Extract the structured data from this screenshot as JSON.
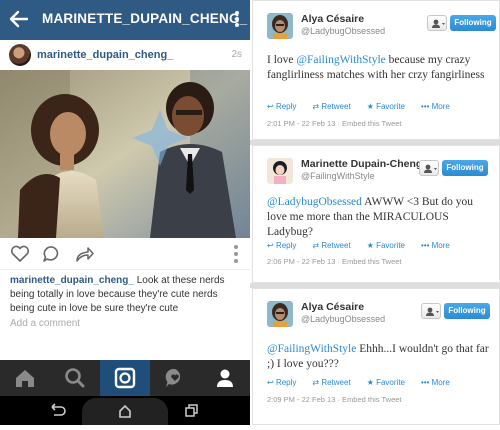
{
  "instagram": {
    "title": "MARINETTE_DUPAIN_CHENG_",
    "username": "marinette_dupain_cheng_",
    "time": "2s",
    "caption_user": "marinette_dupain_cheng_",
    "caption_text": " Look at these nerds being totally in love because they're cute nerds being cute in love be sure they're cute",
    "add_comment": "Add a comment"
  },
  "tweets": [
    {
      "name": "Alya Césaire",
      "handle": "@LadybugObsessed",
      "follow": "Following",
      "text_pre": "I love ",
      "mention": "@FailingWithStyle",
      "text_post": " because my crazy fanglirliness matches with her crzy fangirliness",
      "reply": "Reply",
      "retweet": "Retweet",
      "favorite": "Favorite",
      "more": "More",
      "meta": "2:01 PM - 22 Feb 13 · Embed this Tweet"
    },
    {
      "name": "Marinette Dupain-Cheng",
      "handle": "@FailingWithStyle",
      "follow": "Following",
      "text_pre": "",
      "mention": "@LadybugObsessed",
      "text_post": " AWWW <3 But do you love me more than the MIRACULOUS Ladybug?",
      "reply": "Reply",
      "retweet": "Retweet",
      "favorite": "Favorite",
      "more": "More",
      "meta": "2:06 PM - 22 Feb 13 · Embed this Tweet"
    },
    {
      "name": "Alya Césaire",
      "handle": "@LadybugObsessed",
      "follow": "Following",
      "text_pre": "",
      "mention": "@FailingWithStyle",
      "text_post": " Ehhh...I wouldn't go that far ;) I love you???",
      "reply": "Reply",
      "retweet": "Retweet",
      "favorite": "Favorite",
      "more": "More",
      "meta": "2:09 PM - 22 Feb 13 · Embed this Tweet"
    }
  ],
  "colors": {
    "ig_bar": "#2f5a84",
    "twitter_blue": "#2b8ad4"
  }
}
